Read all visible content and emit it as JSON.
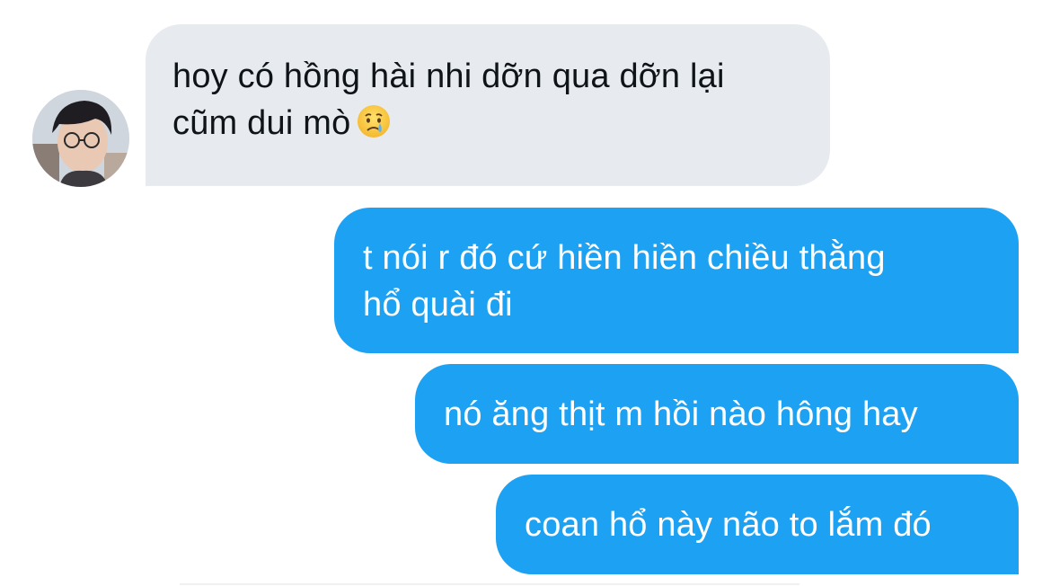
{
  "conversation": {
    "incoming": {
      "lines": [
        "hoy có hồng hài nhi dỡn qua dỡn lại",
        "cũm dui mò"
      ],
      "emoji": "crying-face-emoji"
    },
    "outgoing": [
      {
        "lines": [
          "t nói r đó cứ hiền hiền chiều thằng",
          "hổ quài đi"
        ]
      },
      {
        "lines": [
          "nó ăng thịt m hồi nào hông hay"
        ]
      },
      {
        "lines": [
          "coan hổ này não to lắm đó"
        ]
      }
    ]
  },
  "colors": {
    "incoming_bubble": "#e7ebef",
    "outgoing_bubble": "#1da1f2",
    "incoming_text": "#0f1419",
    "outgoing_text": "#ffffff"
  }
}
